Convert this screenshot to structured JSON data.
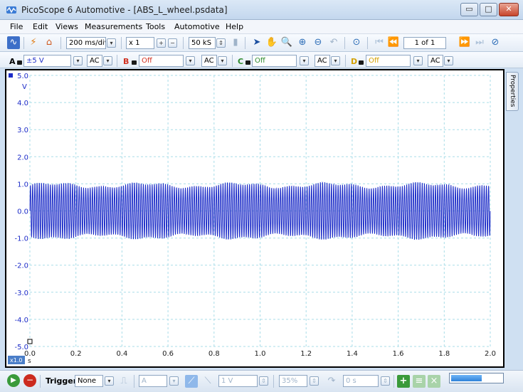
{
  "window": {
    "title": "PicoScope 6 Automotive - [ABS_L_wheel.psdata]",
    "minimize": "▭",
    "maximize": "□",
    "close": "✕"
  },
  "menu": [
    "File",
    "Edit",
    "Views",
    "Measurements",
    "Tools",
    "Automotive",
    "Help"
  ],
  "toolbar": {
    "timebase": "200 ms/div",
    "zoom_factor": "x 1",
    "samples": "50 kS",
    "page_indicator": "1 of 1"
  },
  "channels": [
    {
      "name": "A",
      "range": "±5 V",
      "coupling": "AC",
      "color": "#2030c8"
    },
    {
      "name": "B",
      "range": "Off",
      "coupling": "AC",
      "color": "#d03020"
    },
    {
      "name": "C",
      "range": "Off",
      "coupling": "AC",
      "color": "#2e8b2e"
    },
    {
      "name": "D",
      "range": "Off",
      "coupling": "AC",
      "color": "#d4a000"
    }
  ],
  "properties_tab": "Properties",
  "chart_data": {
    "type": "line",
    "title": "",
    "xlabel": "s",
    "ylabel": "V",
    "x_ticks": [
      "0.0",
      "0.2",
      "0.4",
      "0.6",
      "0.8",
      "1.0",
      "1.2",
      "1.4",
      "1.6",
      "1.8",
      "2.0"
    ],
    "y_ticks": [
      "5.0",
      "4.0",
      "3.0",
      "2.0",
      "1.0",
      "0.0",
      "-1.0",
      "-2.0",
      "-3.0",
      "-4.0",
      "-5.0"
    ],
    "xlim": [
      0,
      2.0
    ],
    "ylim": [
      -5.0,
      5.0
    ],
    "grid": true,
    "x_zoom_badge": "x1.0",
    "series": [
      {
        "name": "A",
        "color": "#1c2cc8",
        "signal": {
          "frequency_hz": 104,
          "amplitude_v": 0.95,
          "offset_v": 0.0,
          "waveform": "sine"
        }
      }
    ]
  },
  "status": {
    "trigger_label": "Trigger",
    "trigger_mode": "None",
    "trigger_source": "A",
    "trigger_level": "1 V",
    "pre_trigger": "35%",
    "delay": "0 s",
    "capture_progress": 0.6
  }
}
